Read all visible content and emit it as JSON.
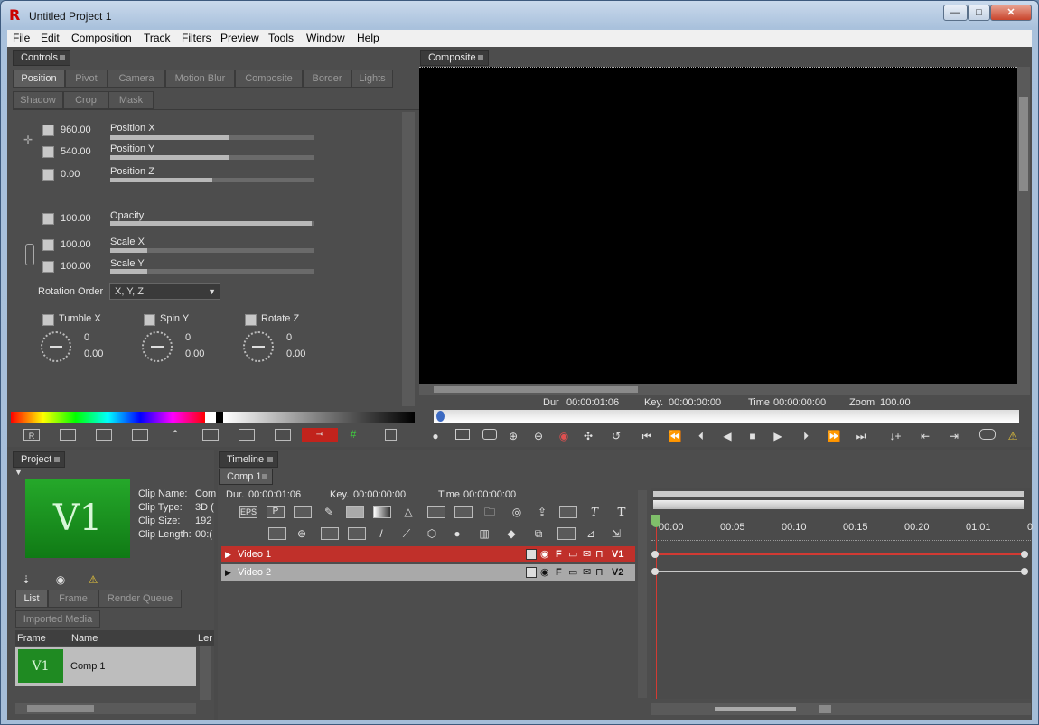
{
  "window": {
    "title": "Untitled Project 1",
    "min": "—",
    "max": "□",
    "close": "✕"
  },
  "menu": [
    "File",
    "Edit",
    "Composition",
    "Track",
    "Filters",
    "Preview",
    "Tools",
    "Window",
    "Help"
  ],
  "controls": {
    "header": "Controls",
    "tabs_row1": [
      "Position",
      "Pivot",
      "Camera",
      "Motion Blur",
      "Composite",
      "Border",
      "Lights"
    ],
    "tabs_row2": [
      "Shadow",
      "Crop",
      "Mask"
    ],
    "active_tab": "Position",
    "params": [
      {
        "value": "960.00",
        "label": "Position X",
        "level": 0.58
      },
      {
        "value": "540.00",
        "label": "Position Y",
        "level": 0.58
      },
      {
        "value": "0.00",
        "label": "Position Z",
        "level": 0.5
      },
      {
        "value": "100.00",
        "label": "Opacity",
        "level": 0.99
      },
      {
        "value": "100.00",
        "label": "Scale X",
        "level": 0.18
      },
      {
        "value": "100.00",
        "label": "Scale Y",
        "level": 0.18
      }
    ],
    "rotation_order_label": "Rotation Order",
    "rotation_order_value": "X, Y, Z",
    "rotations": [
      {
        "label": "Tumble X",
        "turns": "0",
        "degrees": "0.00"
      },
      {
        "label": "Spin Y",
        "turns": "0",
        "degrees": "0.00"
      },
      {
        "label": "Rotate Z",
        "turns": "0",
        "degrees": "0.00"
      }
    ]
  },
  "composite": {
    "header": "Composite",
    "dur_label": "Dur",
    "dur": "00:00:01:06",
    "key_label": "Key.",
    "key": "00:00:00:00",
    "time_label": "Time",
    "time": "00:00:00:00",
    "zoom_label": "Zoom",
    "zoom": "100.00"
  },
  "project": {
    "header": "Project",
    "thumb_text": "V1",
    "info_labels": [
      "Clip Name:",
      "Clip Type:",
      "Clip Size:",
      "Clip Length:"
    ],
    "info_values": [
      "Com",
      "3D (",
      "192",
      "00:("
    ],
    "tabs": [
      "List",
      "Frame",
      "Render Queue"
    ],
    "subtab": "Imported Media",
    "col_frame": "Frame",
    "col_name": "Name",
    "col_len": "Ler",
    "item_name": "Comp 1",
    "item_thumb": "V1"
  },
  "timeline": {
    "header": "Timeline",
    "comp_tab": "Comp 1",
    "dur_label": "Dur.",
    "dur": "00:00:01:06",
    "key_label": "Key.",
    "key": "00:00:00:00",
    "time_label": "Time",
    "time": "00:00:00:00",
    "eps": "EPS",
    "p": "P",
    "tracks": [
      {
        "name": "Video 1",
        "tag": "V1"
      },
      {
        "name": "Video 2",
        "tag": "V2"
      }
    ],
    "ruler": [
      "00:00",
      "00:05",
      "00:10",
      "00:15",
      "00:20",
      "01:01",
      "0"
    ]
  },
  "colors": {
    "accent_red": "#b3322c",
    "panel": "#4d4d4d",
    "thumb_green": "#1f8a22"
  }
}
